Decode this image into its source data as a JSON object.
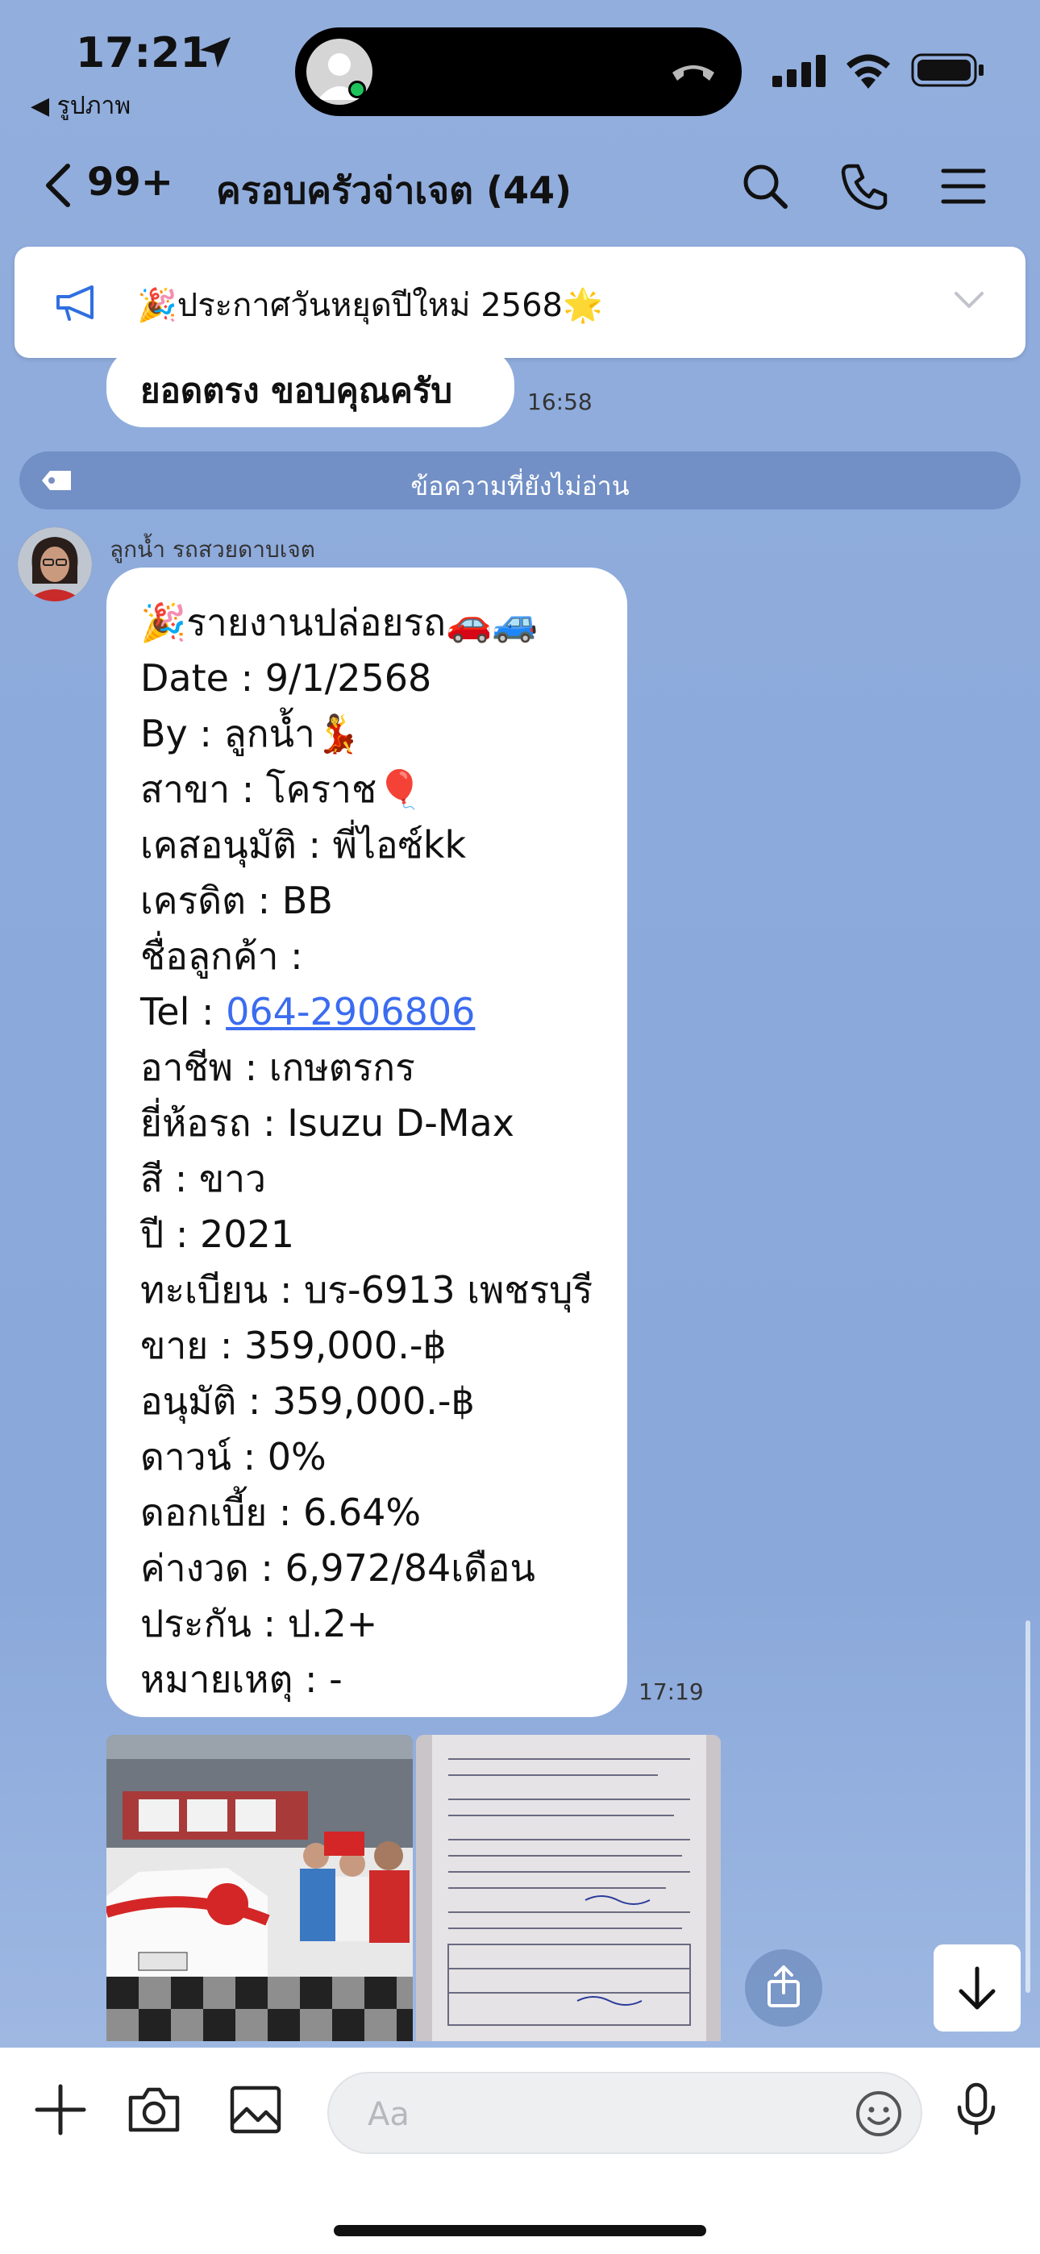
{
  "status_bar": {
    "time": "17:21",
    "back_app": "◀ รูปภาพ"
  },
  "header": {
    "unread_count": "99+",
    "title": "ครอบครัวจ่าเจต (44)"
  },
  "announcement": {
    "text": "🎉ประกาศวันหยุดปีใหม่ 2568🌟"
  },
  "previous_message": {
    "text": "ยอดตรง ขอบคุณครับ",
    "time": "16:58"
  },
  "unread_divider": {
    "text": "ข้อความที่ยังไม่อ่าน"
  },
  "message": {
    "sender": "ลูกน้ำ รถสวยดาบเจต",
    "time": "17:19",
    "lines": [
      "🎉รายงานปล่อยรถ🚗🚙",
      "Date : 9/1/2568",
      "By : ลูกน้ำ💃",
      "สาขา : โคราช🎈",
      "เคสอนุมัติ : พี่ไอซ์kk",
      "เครดิต : BB",
      "ชื่อลูกค้า :"
    ],
    "tel_label": "Tel : ",
    "tel_value": "064-2906806",
    "lines_after": [
      "อาชีพ : เกษตรกร",
      "ยี่ห้อรถ : Isuzu D-Max",
      "สี : ขาว",
      "ปี : 2021",
      "ทะเบียน : บร-6913 เพชรบุรี",
      "ขาย : 359,000.-฿",
      "อนุมัติ : 359,000.-฿",
      "ดาวน์ : 0%",
      "ดอกเบี้ย : 6.64%",
      "ค่างวด : 6,972/84เดือน",
      "ประกัน : ป.2+",
      "หมายเหตุ : -"
    ]
  },
  "input": {
    "placeholder": "Aa"
  },
  "colors": {
    "link": "#3b6cf0",
    "background": "#8ba9db",
    "bubble": "#ffffff"
  }
}
